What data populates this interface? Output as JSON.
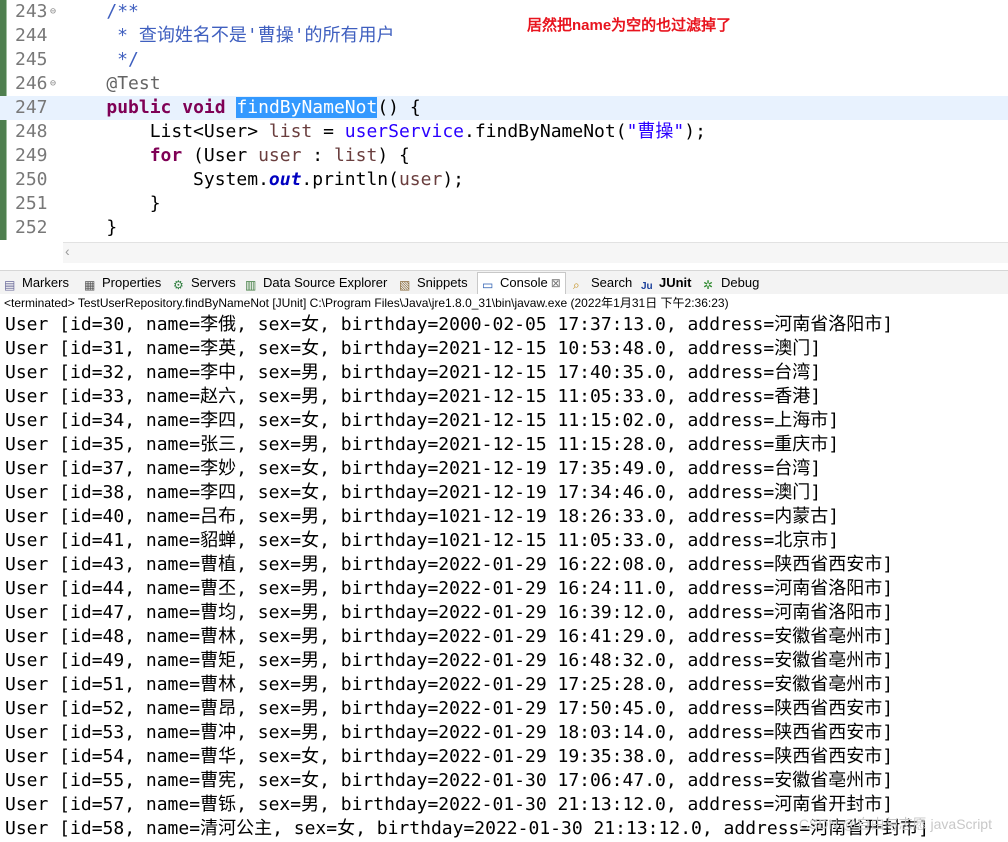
{
  "editor": {
    "annotation_note": "居然把name为空的也过滤掉了",
    "lines": [
      {
        "num": "243",
        "fold": "⊖",
        "segments": [
          {
            "t": "    ",
            "c": ""
          },
          {
            "t": "/**",
            "c": "cm"
          }
        ]
      },
      {
        "num": "244",
        "fold": "",
        "segments": [
          {
            "t": "     * 查询姓名不是'曹操'的所有用户",
            "c": "cm"
          }
        ]
      },
      {
        "num": "245",
        "fold": "",
        "segments": [
          {
            "t": "     */",
            "c": "cm"
          }
        ]
      },
      {
        "num": "246",
        "fold": "⊖",
        "segments": [
          {
            "t": "    ",
            "c": ""
          },
          {
            "t": "@Test",
            "c": "ann"
          }
        ]
      },
      {
        "num": "247",
        "fold": "",
        "segments": [
          {
            "t": "    ",
            "c": ""
          },
          {
            "t": "public",
            "c": "kw"
          },
          {
            "t": " ",
            "c": ""
          },
          {
            "t": "void",
            "c": "kw"
          },
          {
            "t": " ",
            "c": ""
          },
          {
            "t": "findByNameNot",
            "c": "hl"
          },
          {
            "t": "() {",
            "c": ""
          }
        ]
      },
      {
        "num": "248",
        "fold": "",
        "segments": [
          {
            "t": "        List<User> ",
            "c": ""
          },
          {
            "t": "list",
            "c": "var"
          },
          {
            "t": " = ",
            "c": ""
          },
          {
            "t": "userService",
            "c": "str"
          },
          {
            "t": ".findByNameNot(",
            "c": ""
          },
          {
            "t": "\"曹操\"",
            "c": "str"
          },
          {
            "t": ");",
            "c": ""
          }
        ]
      },
      {
        "num": "249",
        "fold": "",
        "segments": [
          {
            "t": "        ",
            "c": ""
          },
          {
            "t": "for",
            "c": "kw"
          },
          {
            "t": " (User ",
            "c": ""
          },
          {
            "t": "user",
            "c": "var"
          },
          {
            "t": " : ",
            "c": ""
          },
          {
            "t": "list",
            "c": "var"
          },
          {
            "t": ") {",
            "c": ""
          }
        ]
      },
      {
        "num": "250",
        "fold": "",
        "segments": [
          {
            "t": "            System.",
            "c": ""
          },
          {
            "t": "out",
            "c": "fld"
          },
          {
            "t": ".println(",
            "c": ""
          },
          {
            "t": "user",
            "c": "var"
          },
          {
            "t": ");",
            "c": ""
          }
        ]
      },
      {
        "num": "251",
        "fold": "",
        "segments": [
          {
            "t": "        }",
            "c": ""
          }
        ]
      },
      {
        "num": "252",
        "fold": "",
        "segments": [
          {
            "t": "    }",
            "c": ""
          }
        ]
      }
    ]
  },
  "view_tabs": [
    {
      "label": "Markers",
      "icon": "markers-icon",
      "active": false
    },
    {
      "label": "Properties",
      "icon": "properties-icon",
      "active": false
    },
    {
      "label": "Servers",
      "icon": "servers-icon",
      "active": false
    },
    {
      "label": "Data Source Explorer",
      "icon": "data-source-icon",
      "active": false
    },
    {
      "label": "Snippets",
      "icon": "snippets-icon",
      "active": false
    },
    {
      "label": "Console",
      "icon": "console-icon",
      "active": true,
      "close": "⊠"
    },
    {
      "label": "Search",
      "icon": "search-icon",
      "active": false
    },
    {
      "label": "JUnit",
      "icon": "junit-icon",
      "active": false
    },
    {
      "label": "Debug",
      "icon": "debug-icon",
      "active": false
    }
  ],
  "console": {
    "status": "<terminated> TestUserRepository.findByNameNot [JUnit] C:\\Program Files\\Java\\jre1.8.0_31\\bin\\javaw.exe (2022年1月31日 下午2:36:23)",
    "lines": [
      "User [id=30, name=李俄, sex=女, birthday=2000-02-05 17:37:13.0, address=河南省洛阳市]",
      "User [id=31, name=李英, sex=女, birthday=2021-12-15 10:53:48.0, address=澳门]",
      "User [id=32, name=李中, sex=男, birthday=2021-12-15 17:40:35.0, address=台湾]",
      "User [id=33, name=赵六, sex=男, birthday=2021-12-15 11:05:33.0, address=香港]",
      "User [id=34, name=李四, sex=女, birthday=2021-12-15 11:15:02.0, address=上海市]",
      "User [id=35, name=张三, sex=男, birthday=2021-12-15 11:15:28.0, address=重庆市]",
      "User [id=37, name=李妙, sex=女, birthday=2021-12-19 17:35:49.0, address=台湾]",
      "User [id=38, name=李四, sex=女, birthday=2021-12-19 17:34:46.0, address=澳门]",
      "User [id=40, name=吕布, sex=男, birthday=1021-12-19 18:26:33.0, address=内蒙古]",
      "User [id=41, name=貂蝉, sex=女, birthday=1021-12-15 11:05:33.0, address=北京市]",
      "User [id=43, name=曹植, sex=男, birthday=2022-01-29 16:22:08.0, address=陕西省西安市]",
      "User [id=44, name=曹丕, sex=男, birthday=2022-01-29 16:24:11.0, address=河南省洛阳市]",
      "User [id=47, name=曹均, sex=男, birthday=2022-01-29 16:39:12.0, address=河南省洛阳市]",
      "User [id=48, name=曹林, sex=男, birthday=2022-01-29 16:41:29.0, address=安徽省亳州市]",
      "User [id=49, name=曹矩, sex=男, birthday=2022-01-29 16:48:32.0, address=安徽省亳州市]",
      "User [id=51, name=曹林, sex=男, birthday=2022-01-29 17:25:28.0, address=安徽省亳州市]",
      "User [id=52, name=曹昂, sex=男, birthday=2022-01-29 17:50:45.0, address=陕西省西安市]",
      "User [id=53, name=曹冲, sex=男, birthday=2022-01-29 18:03:14.0, address=陕西省西安市]",
      "User [id=54, name=曹华, sex=女, birthday=2022-01-29 19:35:38.0, address=陕西省西安市]",
      "User [id=55, name=曹宪, sex=女, birthday=2022-01-30 17:06:47.0, address=安徽省亳州市]",
      "User [id=57, name=曹铄, sex=男, birthday=2022-01-30 21:13:12.0, address=河南省开封市]",
      "User [id=58, name=清河公主, sex=女, birthday=2022-01-30 21:13:12.0, address=河南省开封市]"
    ]
  },
  "watermark": "CSDN @自由与志愿 javaScript"
}
